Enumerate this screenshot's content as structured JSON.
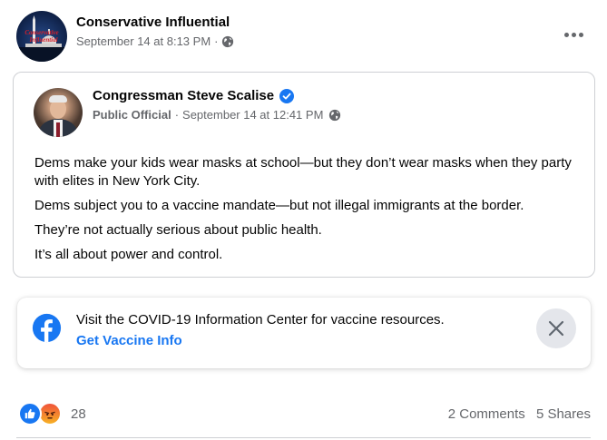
{
  "post": {
    "page_name": "Conservative Influential",
    "avatar_text": "Conservative Influential",
    "timestamp": "September 14 at 8:13 PM",
    "separator": "·",
    "privacy_icon": "globe-icon",
    "more_icon": "more-horizontal-icon"
  },
  "shared": {
    "author_name": "Congressman Steve Scalise",
    "verified_icon": "verified-badge-icon",
    "role": "Public Official",
    "separator": "·",
    "timestamp": "September 14 at 12:41 PM",
    "privacy_icon": "globe-icon",
    "paragraphs": [
      "Dems make your kids wear masks at school—but they don’t wear masks when they party with elites in New York City.",
      "Dems subject you to a vaccine mandate—but not illegal immigrants at the border.",
      "They’re not actually serious about public health.",
      "It’s all about power and control."
    ]
  },
  "info_card": {
    "icon": "facebook-logo-icon",
    "text": "Visit the COVID-19 Information Center for vaccine resources.",
    "link": "Get Vaccine Info",
    "close_icon": "close-icon"
  },
  "footer": {
    "reaction_icons": [
      "like-icon",
      "angry-icon"
    ],
    "reaction_count": "28",
    "comments": "2 Comments",
    "shares": "5 Shares"
  },
  "colors": {
    "accent": "#1877f2",
    "secondary_text": "#65676b",
    "border": "#ced0d4",
    "close_bg": "#e4e6eb"
  }
}
